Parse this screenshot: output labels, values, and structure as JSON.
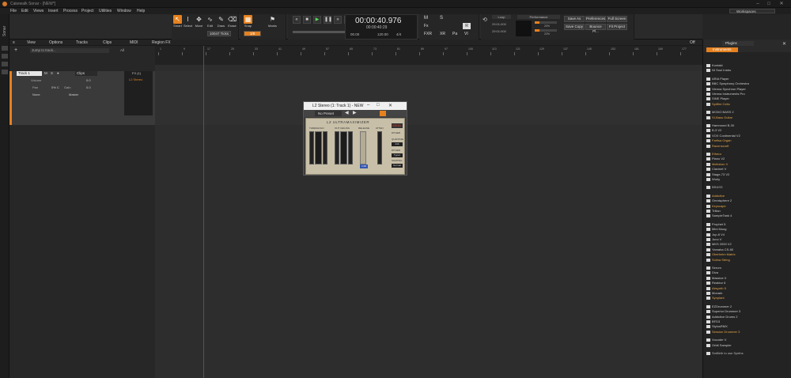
{
  "window": {
    "title": "Cakewalk Sonar - [NEW*]"
  },
  "menu": [
    "File",
    "Edit",
    "Views",
    "Insert",
    "Process",
    "Project",
    "Utilities",
    "Window",
    "Help"
  ],
  "workspace": "Workspaces",
  "sidebar_label": "Sonar",
  "tools": {
    "smart": "Smart",
    "select": "Select",
    "move": "Move",
    "edit": "Edit",
    "draw": "Draw",
    "erase": "Erase",
    "snap": "Snap",
    "marks": "Marks",
    "ticks": "10047 Ticks",
    "snap_val": "1/8"
  },
  "transport": {
    "time": "00:00:40.976",
    "sub": "00:00:40:29",
    "bpm": "120.00",
    "meter": "4/4",
    "key": "C",
    "beats": "00.00"
  },
  "toggles": {
    "m": "M",
    "s": "S",
    "fx": "Fx",
    "fxr": "FXR",
    "xr": "XR",
    "pa": "Pa",
    "vi": "VI",
    "r": "R"
  },
  "loop": {
    "title": "Loop",
    "start": "29:01:000",
    "end": "29:01:000"
  },
  "perf": {
    "title": "Performance",
    "a": "20%",
    "b": "22%"
  },
  "right_buttons": [
    "Save As",
    "Preferences",
    "Full Screen",
    "Save Copy",
    "Bounce Pl...",
    "Fit Project"
  ],
  "track_toolbar": {
    "view": "View",
    "options": "Options",
    "tracks": "Tracks",
    "clips": "Clips",
    "midi": "MIDI",
    "regionfx": "Region FX",
    "jump": "Jump to track...",
    "all": "All",
    "off": "Off"
  },
  "track": {
    "name": "Track 1",
    "volume_label": "Volume",
    "volume": "0.0",
    "pan_label": "Pan",
    "pan": "0% C",
    "gain_label": "Gain",
    "gain": "0.0",
    "input": "None",
    "output": "Master",
    "fx": "FX (1)",
    "plugin": "L2 Stereo",
    "clips": "Clips"
  },
  "ruler": {
    "bars": [
      "1",
      "9",
      "17",
      "25",
      "33",
      "41",
      "49",
      "57",
      "65",
      "73",
      "81",
      "89",
      "97",
      "105",
      "113",
      "121",
      "129",
      "137",
      "145",
      "153",
      "161",
      "169",
      "177"
    ]
  },
  "plugin": {
    "title": "L2 Stereo (1: Track 1) - NEW",
    "preset": "No Preset",
    "brand": "L2 ULTRAMAXIMIZER",
    "threshold": "THRESHOLD",
    "out_ceiling": "OUT CEILING",
    "release": "RELEASE",
    "atten": "ATTEN",
    "dither": "DITHER",
    "shaping": "SHAPING",
    "quantize": "QUANTIZE",
    "domain": "DOMAIN",
    "release_val": "1.00",
    "arc": "ARC",
    "quant_val": "24b",
    "type1": "Type1",
    "normal": "Normal",
    "ideal": "IDEAL"
  },
  "browser": {
    "tab": "Plugins",
    "sub": "Instruments",
    "items": [
      {
        "t": "Kontakt",
        "k": "item"
      },
      {
        "t": "NI Soul Instru",
        "k": "item"
      },
      {
        "t": "ARIA Player",
        "k": "item"
      },
      {
        "t": "BBC Symphony Orchestra",
        "k": "item"
      },
      {
        "t": "Vienna Synchron Player",
        "k": "item"
      },
      {
        "t": "Vienna Instruments Pro",
        "k": "item"
      },
      {
        "t": "SINE Player",
        "k": "item"
      },
      {
        "t": "Spitfire Cello",
        "k": "active"
      },
      {
        "t": "MODO BASS 2",
        "k": "item"
      },
      {
        "t": "SI-Bass Guitar",
        "k": "active"
      },
      {
        "t": "Hammond B-3X",
        "k": "item"
      },
      {
        "t": "B-3 V2",
        "k": "item"
      },
      {
        "t": "VOX Continental V2",
        "k": "item"
      },
      {
        "t": "Farfisa Organ",
        "k": "active"
      },
      {
        "t": "Ravenscroft",
        "k": "active"
      },
      {
        "t": "Ethera",
        "k": "active"
      },
      {
        "t": "Piano V2",
        "k": "item"
      },
      {
        "t": "Mellotron V",
        "k": "active"
      },
      {
        "t": "Clavinet V",
        "k": "item"
      },
      {
        "t": "Stage-73 V2",
        "k": "item"
      },
      {
        "t": "Wurly",
        "k": "item"
      },
      {
        "t": "BRASS",
        "k": "cat"
      },
      {
        "t": "Addictive",
        "k": "active"
      },
      {
        "t": "Omnisphere 2",
        "k": "item"
      },
      {
        "t": "Keyscape",
        "k": "active"
      },
      {
        "t": "Trilian",
        "k": "item"
      },
      {
        "t": "SampleTank 4",
        "k": "item"
      },
      {
        "t": "Prophet 5",
        "k": "item"
      },
      {
        "t": "Mini Moog",
        "k": "item"
      },
      {
        "t": "Jup-8 V4",
        "k": "item"
      },
      {
        "t": "Juno V",
        "k": "item"
      },
      {
        "t": "MKS 2000 V2",
        "k": "item"
      },
      {
        "t": "Yamaha CS-80",
        "k": "item"
      },
      {
        "t": "Oberheim Matrix",
        "k": "active"
      },
      {
        "t": "Solina String",
        "k": "active"
      },
      {
        "t": "Serum",
        "k": "item"
      },
      {
        "t": "Diva",
        "k": "item"
      },
      {
        "t": "Massive X",
        "k": "item"
      },
      {
        "t": "Reaktor 6",
        "k": "item"
      },
      {
        "t": "Absynth 5",
        "k": "active"
      },
      {
        "t": "Monark",
        "k": "item"
      },
      {
        "t": "Synplant",
        "k": "active"
      },
      {
        "t": "EZDrummer 2",
        "k": "item"
      },
      {
        "t": "Superior Drummer 3",
        "k": "item"
      },
      {
        "t": "Addictive Drums 2",
        "k": "item"
      },
      {
        "t": "BFD3",
        "k": "item"
      },
      {
        "t": "StylusRMX",
        "k": "item"
      },
      {
        "t": "Session Drummer 3",
        "k": "active"
      },
      {
        "t": "Vocoder V",
        "k": "item"
      },
      {
        "t": "Orbit Sampler",
        "k": "item"
      },
      {
        "t": "SmBirth to use Synths",
        "k": "cat"
      }
    ]
  },
  "colors": {
    "accent": "#e5811f",
    "bg": "#252525"
  }
}
